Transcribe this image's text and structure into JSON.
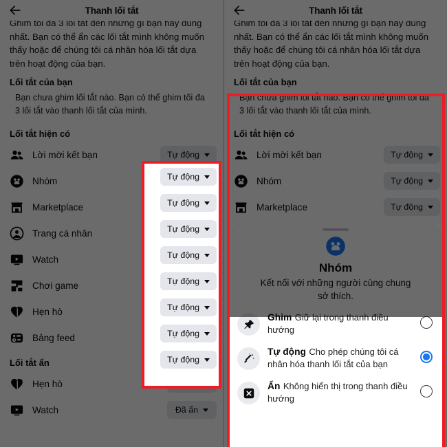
{
  "header": {
    "title": "Thanh lối tắt",
    "back_icon": "back-arrow-icon"
  },
  "intro": {
    "paragraph_clipped": "Ghim tối đa 3 lối tắt đến những gì bạn hay dùng nhất. Bạn có thể ẩn các lối tắt mình không muốn thấy hoặc để chúng tôi cá nhân hóa lối tắt dựa trên hoạt động của bạn."
  },
  "your_shortcuts": {
    "title": "Lối tắt của bạn",
    "empty_note": "Bạn chưa ghim lối tắt nào. Bạn có thể ghim tối đa 3 lối tắt vào thanh lối tắt của mình."
  },
  "available": {
    "title": "Lối tắt hiện có",
    "items": [
      {
        "label": "Lời mời kết bạn",
        "icon": "friends-icon",
        "value": "Tự động"
      },
      {
        "label": "Nhóm",
        "icon": "groups-icon",
        "value": "Tự động"
      },
      {
        "label": "Marketplace",
        "icon": "marketplace-icon",
        "value": "Tự động"
      },
      {
        "label": "Trang cá nhân",
        "icon": "profile-icon",
        "value": "Tự động"
      },
      {
        "label": "Watch",
        "icon": "watch-icon",
        "value": "Tự động"
      },
      {
        "label": "Chơi game",
        "icon": "gaming-icon",
        "value": "Tự động"
      },
      {
        "label": "Hẹn hò",
        "icon": "dating-icon",
        "value": "Tự động"
      },
      {
        "label": "Bảng feed",
        "icon": "feeds-icon",
        "value": "Tự động"
      }
    ]
  },
  "hidden": {
    "title": "Lối tắt ẩn",
    "items": [
      {
        "label": "Hẹn hò",
        "icon": "dating-icon",
        "value": "Đã ẩn"
      },
      {
        "label": "Watch",
        "icon": "watch-icon",
        "value": "Đã ẩn"
      }
    ]
  },
  "sheet": {
    "glyph_icon": "groups-circle-icon",
    "title": "Nhóm",
    "subtitle": "Kết nối với những người cùng chung sở thích.",
    "options": [
      {
        "icon": "pin-icon",
        "title": "Ghim",
        "desc": "Giữ lại trong thanh điều hướng",
        "selected": false
      },
      {
        "icon": "magic-wand-icon",
        "title": "Tự động",
        "desc": "Cho phép chúng tôi cá nhân hóa thanh lối tắt của bạn",
        "selected": true
      },
      {
        "icon": "hide-x-icon",
        "title": "Ẩn",
        "desc": "Không hiển thị trong thanh điều hướng",
        "selected": false
      }
    ]
  },
  "annotations": {
    "highlight_color": "#ee1c24",
    "accent_color": "#1877f2",
    "chip_color": "#e4e6eb"
  }
}
